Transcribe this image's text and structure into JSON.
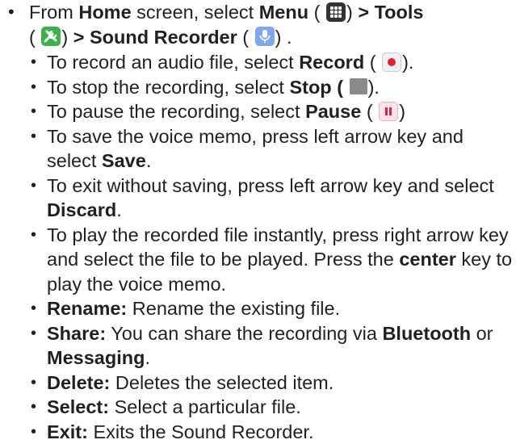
{
  "main": {
    "intro": {
      "t1": "From ",
      "home": "Home",
      "t2": " screen, select ",
      "menu": "Menu",
      "t3": " (",
      "t4": ") ",
      "tools": "> Tools",
      "t5": "(",
      "t6": ") ",
      "sound": "> Sound Recorder",
      "t7": " (",
      "t8": ") ."
    },
    "items": [
      {
        "pre": "To record an audio file, select ",
        "bold": "Record",
        "post": " (",
        "post2": ")."
      },
      {
        "pre": "To stop the recording, select ",
        "bold": "Stop (",
        "post2": ")."
      },
      {
        "pre": "To pause the recording, select ",
        "bold": "Pause",
        "post": " (",
        "post2": ")"
      },
      {
        "pre": "To save the voice memo, press left arrow key and select ",
        "bold": "Save",
        "post2": "."
      },
      {
        "pre": "To exit without saving, press left arrow key and select ",
        "bold": "Discard",
        "post2": "."
      },
      {
        "pre": "To play the recorded file instantly, press right arrow key and select the file to be played. Press the ",
        "bold": "center",
        "post2": " key to play the voice memo."
      },
      {
        "bold": "Rename:",
        "post2": " Rename the existing file."
      },
      {
        "bold": "Share:",
        "post2": " You can share the recording via ",
        "bold2": "Bluetooth",
        "post3": " or ",
        "bold3": "Messaging",
        "post4": "."
      },
      {
        "bold": "Delete:",
        "post2": " Deletes the selected item."
      },
      {
        "bold": "Select:",
        "post2": " Select a particular file."
      },
      {
        "bold": "Exit:",
        "post2": " Exits the Sound Recorder."
      }
    ],
    "icons": {
      "menu": "grid-icon",
      "tools": "tools-icon",
      "sound": "microphone-icon",
      "record": "record-icon",
      "stop": "stop-icon",
      "pause": "pause-icon"
    },
    "colors": {
      "text": "#231f20",
      "tools": "#3bb34a",
      "sound": "#7ea7ee",
      "record": "#e21f2e"
    }
  }
}
